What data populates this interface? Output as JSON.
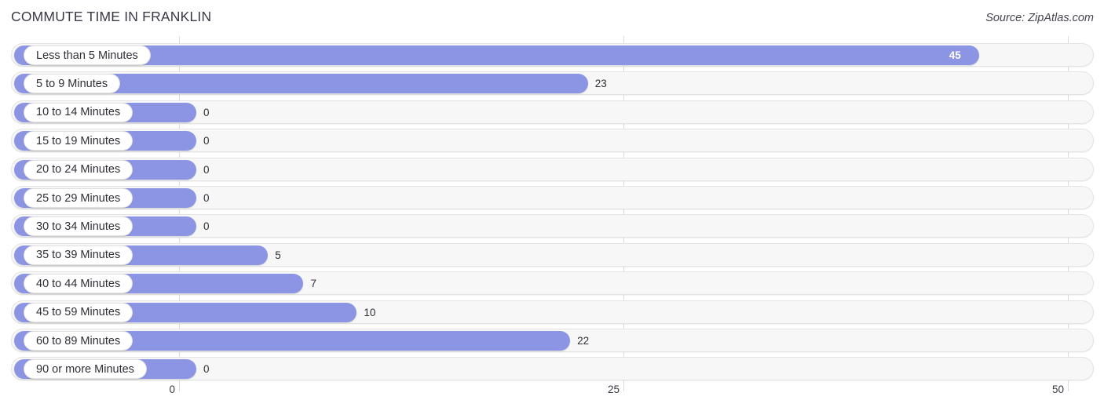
{
  "header": {
    "title": "COMMUTE TIME IN FRANKLIN",
    "source": "Source: ZipAtlas.com"
  },
  "chart_data": {
    "type": "bar",
    "orientation": "horizontal",
    "title": "COMMUTE TIME IN FRANKLIN",
    "subtitle": "",
    "xlabel": "",
    "ylabel": "",
    "xlim": [
      0,
      50
    ],
    "grid": true,
    "legend": false,
    "source": "Source: ZipAtlas.com",
    "xticks": [
      "0",
      "25",
      "50"
    ],
    "xtick_values": [
      0,
      25,
      50
    ],
    "categories": [
      "Less than 5 Minutes",
      "5 to 9 Minutes",
      "10 to 14 Minutes",
      "15 to 19 Minutes",
      "20 to 24 Minutes",
      "25 to 29 Minutes",
      "30 to 34 Minutes",
      "35 to 39 Minutes",
      "40 to 44 Minutes",
      "45 to 59 Minutes",
      "60 to 89 Minutes",
      "90 or more Minutes"
    ],
    "values": [
      45,
      23,
      0,
      0,
      0,
      0,
      0,
      5,
      7,
      10,
      22,
      0
    ],
    "value_labels": [
      "45",
      "23",
      "0",
      "0",
      "0",
      "0",
      "0",
      "5",
      "7",
      "10",
      "22",
      "0"
    ],
    "colors": {
      "bar": "#8b95e3",
      "track": "#f7f7f7",
      "track_border": "#e3e3e3",
      "label_pill": "#ffffff",
      "gridline": "#dcdcdc",
      "text": "#2f2f38",
      "title": "#3a3a46",
      "background": "#ffffff"
    }
  }
}
